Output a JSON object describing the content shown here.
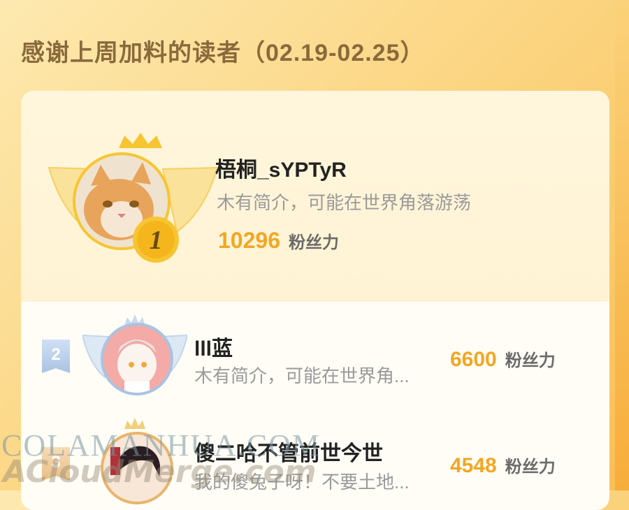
{
  "header": {
    "title": "感谢上周加料的读者（02.19-02.25）"
  },
  "readers": [
    {
      "rank": "1",
      "name": "梧桐_sYPTyR",
      "bio": "木有简介，可能在世界角落游荡",
      "score": "10296",
      "unit": "粉丝力"
    },
    {
      "rank": "2",
      "name": "lll蓝",
      "bio": "木有简介，可能在世界角...",
      "score": "6600",
      "unit": "粉丝力"
    },
    {
      "rank": "3",
      "name": "傻二哈不管前世今世",
      "bio": "我的傻兔子呀！不要土地...",
      "score": "4548",
      "unit": "粉丝力"
    }
  ],
  "watermarks": {
    "line1": "COLAMANHUA.COM",
    "line2": "ACloudMerge.com"
  },
  "colors": {
    "accent": "#f3a623",
    "gold": "#f7c531",
    "silver": "#a9c3e3"
  },
  "icons": {
    "crown": "crown-icon",
    "wings": "wings-icon"
  }
}
